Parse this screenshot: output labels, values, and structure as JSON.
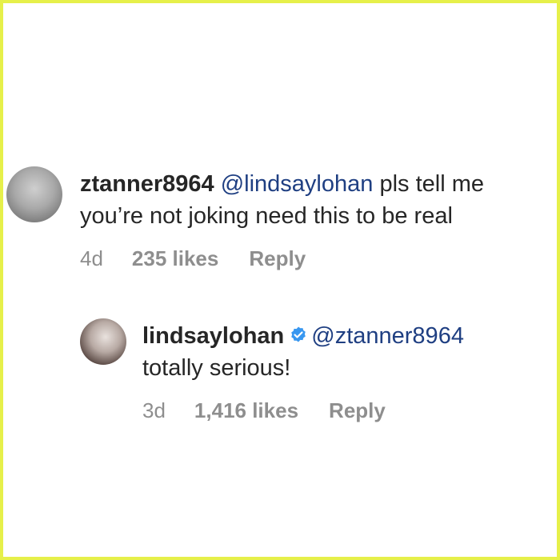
{
  "comments": [
    {
      "username": "ztanner8964",
      "mention": "@lindsaylohan",
      "text": " pls tell me you’re not joking need this to be real",
      "time": "4d",
      "likes": "235 likes",
      "reply_label": "Reply",
      "verified": false
    },
    {
      "username": "lindsaylohan",
      "mention": "@ztanner8964",
      "text": "totally serious!",
      "time": "3d",
      "likes": "1,416 likes",
      "reply_label": "Reply",
      "verified": true
    }
  ],
  "colors": {
    "border": "#e6f04a",
    "text": "#262626",
    "mention": "#1f3f82",
    "meta": "#8e8e8e",
    "verified": "#3897f0"
  }
}
